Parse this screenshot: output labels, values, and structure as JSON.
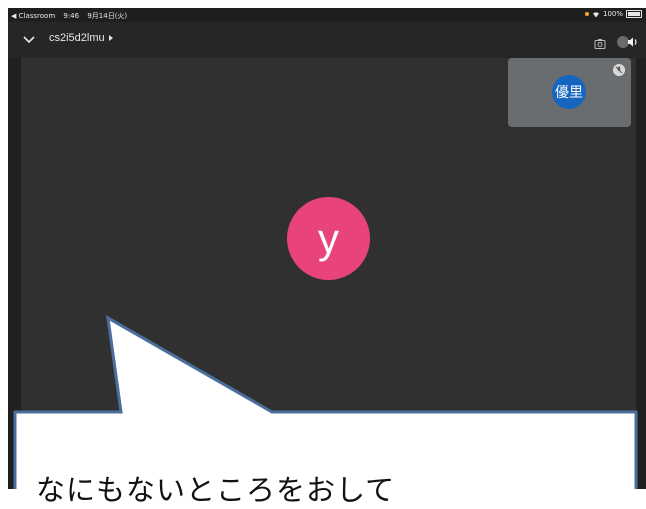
{
  "status_bar": {
    "back_app": "◀ Classroom",
    "time": "9:46",
    "date": "9月14日(火)",
    "battery_text": "100%",
    "battery_level": 1.0
  },
  "meeting": {
    "code": "cs2i5d2lmu"
  },
  "participants": {
    "main": {
      "initial": "y",
      "color": "#e8437a"
    },
    "self": {
      "name": "優里",
      "color": "#1565c0",
      "muted": true
    }
  },
  "annotation": {
    "callout_text": "なにもないところをおして"
  },
  "icons": {
    "collapse": "chevron-down-icon",
    "switch_camera": "camera-switch-icon",
    "audio": "speaker-icon",
    "mute": "mic-off-icon",
    "wifi": "wifi-icon",
    "battery": "battery-icon"
  }
}
